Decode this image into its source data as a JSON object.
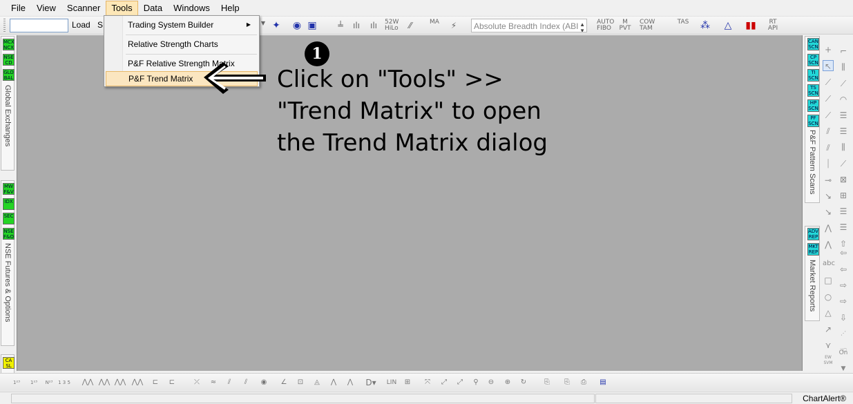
{
  "menubar": {
    "items": [
      "File",
      "View",
      "Scanner",
      "Tools",
      "Data",
      "Windows",
      "Help"
    ],
    "active": "Tools"
  },
  "toolbar": {
    "symbol_value": "",
    "load_label": "Load",
    "s_label": "S",
    "indicator_value": "Absolute Breadth Index (ABI",
    "icon_labels": [
      "52W HiLo",
      "MA",
      "AUTO FIBO",
      "M PVT",
      "COW TAM",
      "TAS",
      "RT API"
    ]
  },
  "tools_menu": {
    "items": [
      {
        "label": "Trading System Builder",
        "submenu": true
      },
      {
        "label": "Relative Strength Charts",
        "submenu": false
      },
      {
        "label": "P&F Relative Strength Matrix",
        "submenu": false
      },
      {
        "label": "P&F Trend Matrix",
        "submenu": false,
        "highlighted": true
      }
    ]
  },
  "left_sidebar": {
    "panel1_buttons": [
      "MCX NCX",
      "NSE CD",
      "GLO BAL"
    ],
    "panel1_label": "Global Exchanges",
    "panel2_buttons": [
      "MW F&V",
      "IDX",
      "SEC",
      "NSE F&O"
    ],
    "panel2_label": "NSE Futures & Options",
    "panel3_buttons": [
      "CA SL"
    ]
  },
  "right_sidebar": {
    "panel1_buttons": [
      "CAN SCN",
      "CP SCN",
      "TI SCN",
      "TS SCN",
      "HP SCN",
      "PF SCN"
    ],
    "panel1_label": "P&F Pattern Scans",
    "panel2_buttons": [
      "ADV REP",
      "MKT REP"
    ],
    "panel2_label": "Market Reports"
  },
  "drawing_tools": {
    "text_tool": "abc",
    "on_label": "On",
    "ew_label": "EW SVM"
  },
  "bottom_toolbar": {
    "lin_label": "LIN"
  },
  "annotation": {
    "number": "1",
    "lines": [
      "Click on \"Tools\" >>",
      "\"Trend Matrix\" to open",
      "the Trend Matrix dialog"
    ]
  },
  "statusbar": {
    "brand": "ChartAlert®"
  },
  "colors": {
    "chart_background": "#ababab",
    "menu_highlight": "#fbe6c0",
    "left_button_green": "#24d424",
    "right_button_cyan": "#22d8d8"
  }
}
